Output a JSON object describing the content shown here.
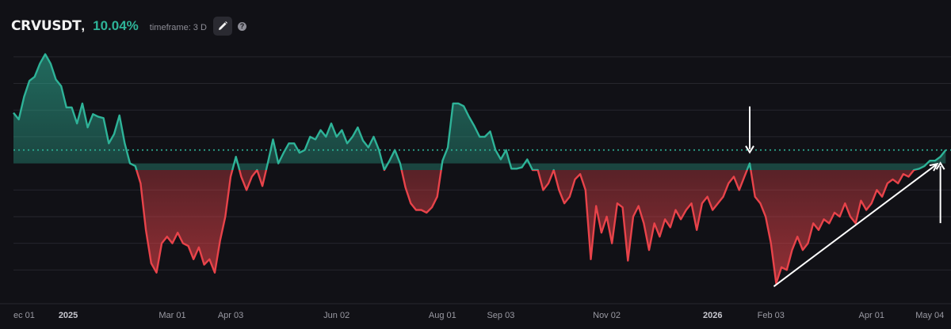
{
  "header": {
    "symbol": "CRVUSDT",
    "comma": ",",
    "change": "10.04%",
    "timeframe": "timeframe: 3 D",
    "edit_icon": "pencil-icon",
    "help_icon": "question-icon",
    "help_glyph": "?"
  },
  "colors": {
    "background": "#111116",
    "positive": "#2eb398",
    "negative": "#e8434a",
    "gridline": "#26262d",
    "annotation": "#ffffff"
  },
  "chart_data": {
    "type": "area",
    "title": "",
    "xlabel": "",
    "ylabel": "",
    "x_range": [
      "2024-12-01",
      "2026-05-16"
    ],
    "ylim": [
      -100,
      90
    ],
    "grid": true,
    "baseline": 0,
    "reference_line": {
      "value": 10.04,
      "style": "dotted"
    },
    "x_ticks": [
      {
        "label": "ec 01",
        "date": "2024-12-01",
        "year": false
      },
      {
        "label": "2025",
        "date": "2025-01-01",
        "year": true
      },
      {
        "label": "Mar 01",
        "date": "2025-03-01",
        "year": false
      },
      {
        "label": "Apr 03",
        "date": "2025-04-03",
        "year": false
      },
      {
        "label": "Jun 02",
        "date": "2025-06-02",
        "year": false
      },
      {
        "label": "Aug 01",
        "date": "2025-08-01",
        "year": false
      },
      {
        "label": "Sep 03",
        "date": "2025-09-03",
        "year": false
      },
      {
        "label": "Nov 02",
        "date": "2025-11-02",
        "year": false
      },
      {
        "label": "2026",
        "date": "2026-01-01",
        "year": true
      },
      {
        "label": "Feb 03",
        "date": "2026-02-03",
        "year": false
      },
      {
        "label": "Apr 01",
        "date": "2026-04-01",
        "year": false
      },
      {
        "label": "May 04",
        "date": "2026-05-04",
        "year": false
      }
    ],
    "series": [
      {
        "points": [
          [
            "2024-12-01",
            38
          ],
          [
            "2024-12-04",
            33
          ],
          [
            "2024-12-07",
            50
          ],
          [
            "2024-12-10",
            62
          ],
          [
            "2024-12-13",
            65
          ],
          [
            "2024-12-16",
            75
          ],
          [
            "2024-12-19",
            82
          ],
          [
            "2024-12-22",
            75
          ],
          [
            "2024-12-25",
            63
          ],
          [
            "2024-12-28",
            58
          ],
          [
            "2024-12-31",
            42
          ],
          [
            "2025-01-03",
            42
          ],
          [
            "2025-01-06",
            30
          ],
          [
            "2025-01-09",
            45
          ],
          [
            "2025-01-12",
            27
          ],
          [
            "2025-01-15",
            37
          ],
          [
            "2025-01-18",
            35
          ],
          [
            "2025-01-21",
            34
          ],
          [
            "2025-01-24",
            15
          ],
          [
            "2025-01-27",
            22
          ],
          [
            "2025-01-30",
            36
          ],
          [
            "2025-02-02",
            15
          ],
          [
            "2025-02-05",
            0
          ],
          [
            "2025-02-08",
            -2
          ],
          [
            "2025-02-11",
            -15
          ],
          [
            "2025-02-14",
            -50
          ],
          [
            "2025-02-17",
            -75
          ],
          [
            "2025-02-20",
            -82
          ],
          [
            "2025-02-23",
            -60
          ],
          [
            "2025-02-26",
            -55
          ],
          [
            "2025-03-01",
            -60
          ],
          [
            "2025-03-04",
            -52
          ],
          [
            "2025-03-07",
            -60
          ],
          [
            "2025-03-10",
            -62
          ],
          [
            "2025-03-13",
            -72
          ],
          [
            "2025-03-16",
            -63
          ],
          [
            "2025-03-19",
            -76
          ],
          [
            "2025-03-22",
            -72
          ],
          [
            "2025-03-25",
            -82
          ],
          [
            "2025-03-28",
            -58
          ],
          [
            "2025-03-31",
            -40
          ],
          [
            "2025-04-03",
            -10
          ],
          [
            "2025-04-06",
            5
          ],
          [
            "2025-04-09",
            -10
          ],
          [
            "2025-04-12",
            -20
          ],
          [
            "2025-04-15",
            -10
          ],
          [
            "2025-04-18",
            -5
          ],
          [
            "2025-04-21",
            -17
          ],
          [
            "2025-04-24",
            0
          ],
          [
            "2025-04-27",
            18
          ],
          [
            "2025-04-30",
            0
          ],
          [
            "2025-05-03",
            8
          ],
          [
            "2025-05-06",
            15
          ],
          [
            "2025-05-09",
            15
          ],
          [
            "2025-05-12",
            8
          ],
          [
            "2025-05-15",
            10
          ],
          [
            "2025-05-18",
            20
          ],
          [
            "2025-05-21",
            18
          ],
          [
            "2025-05-24",
            25
          ],
          [
            "2025-05-27",
            20
          ],
          [
            "2025-05-30",
            30
          ],
          [
            "2025-06-02",
            20
          ],
          [
            "2025-06-05",
            25
          ],
          [
            "2025-06-08",
            15
          ],
          [
            "2025-06-11",
            20
          ],
          [
            "2025-06-14",
            27
          ],
          [
            "2025-06-17",
            17
          ],
          [
            "2025-06-20",
            12
          ],
          [
            "2025-06-23",
            20
          ],
          [
            "2025-06-26",
            10
          ],
          [
            "2025-06-29",
            -5
          ],
          [
            "2025-07-02",
            2
          ],
          [
            "2025-07-05",
            10
          ],
          [
            "2025-07-08",
            0
          ],
          [
            "2025-07-11",
            -18
          ],
          [
            "2025-07-14",
            -30
          ],
          [
            "2025-07-17",
            -35
          ],
          [
            "2025-07-20",
            -35
          ],
          [
            "2025-07-23",
            -37
          ],
          [
            "2025-07-26",
            -33
          ],
          [
            "2025-07-29",
            -25
          ],
          [
            "2025-08-01",
            2
          ],
          [
            "2025-08-04",
            12
          ],
          [
            "2025-08-07",
            45
          ],
          [
            "2025-08-10",
            45
          ],
          [
            "2025-08-13",
            43
          ],
          [
            "2025-08-16",
            35
          ],
          [
            "2025-08-19",
            28
          ],
          [
            "2025-08-22",
            20
          ],
          [
            "2025-08-25",
            20
          ],
          [
            "2025-08-28",
            24
          ],
          [
            "2025-08-31",
            10
          ],
          [
            "2025-09-03",
            3
          ],
          [
            "2025-09-06",
            10
          ],
          [
            "2025-09-09",
            -4
          ],
          [
            "2025-09-12",
            -4
          ],
          [
            "2025-09-15",
            -3
          ],
          [
            "2025-09-18",
            3
          ],
          [
            "2025-09-21",
            -5
          ],
          [
            "2025-09-24",
            -5
          ],
          [
            "2025-09-27",
            -20
          ],
          [
            "2025-09-30",
            -15
          ],
          [
            "2025-10-03",
            -5
          ],
          [
            "2025-10-06",
            -20
          ],
          [
            "2025-10-09",
            -30
          ],
          [
            "2025-10-12",
            -25
          ],
          [
            "2025-10-15",
            -12
          ],
          [
            "2025-10-18",
            -8
          ],
          [
            "2025-10-21",
            -20
          ],
          [
            "2025-10-24",
            -72
          ],
          [
            "2025-10-27",
            -32
          ],
          [
            "2025-10-30",
            -52
          ],
          [
            "2025-11-02",
            -40
          ],
          [
            "2025-11-05",
            -60
          ],
          [
            "2025-11-08",
            -30
          ],
          [
            "2025-11-11",
            -33
          ],
          [
            "2025-11-14",
            -73
          ],
          [
            "2025-11-17",
            -40
          ],
          [
            "2025-11-20",
            -32
          ],
          [
            "2025-11-23",
            -45
          ],
          [
            "2025-11-26",
            -65
          ],
          [
            "2025-11-29",
            -45
          ],
          [
            "2025-12-02",
            -55
          ],
          [
            "2025-12-05",
            -42
          ],
          [
            "2025-12-08",
            -48
          ],
          [
            "2025-12-11",
            -35
          ],
          [
            "2025-12-14",
            -42
          ],
          [
            "2025-12-17",
            -35
          ],
          [
            "2025-12-20",
            -30
          ],
          [
            "2025-12-23",
            -50
          ],
          [
            "2025-12-26",
            -30
          ],
          [
            "2025-12-29",
            -25
          ],
          [
            "2026-01-01",
            -35
          ],
          [
            "2026-01-04",
            -30
          ],
          [
            "2026-01-07",
            -25
          ],
          [
            "2026-01-10",
            -15
          ],
          [
            "2026-01-13",
            -10
          ],
          [
            "2026-01-16",
            -20
          ],
          [
            "2026-01-19",
            -10
          ],
          [
            "2026-01-22",
            0
          ],
          [
            "2026-01-25",
            -25
          ],
          [
            "2026-01-28",
            -30
          ],
          [
            "2026-01-31",
            -40
          ],
          [
            "2026-02-03",
            -60
          ],
          [
            "2026-02-06",
            -90
          ],
          [
            "2026-02-09",
            -78
          ],
          [
            "2026-02-12",
            -80
          ],
          [
            "2026-02-15",
            -65
          ],
          [
            "2026-02-18",
            -55
          ],
          [
            "2026-02-21",
            -65
          ],
          [
            "2026-02-24",
            -60
          ],
          [
            "2026-02-27",
            -45
          ],
          [
            "2026-03-02",
            -50
          ],
          [
            "2026-03-05",
            -42
          ],
          [
            "2026-03-08",
            -45
          ],
          [
            "2026-03-11",
            -37
          ],
          [
            "2026-03-14",
            -40
          ],
          [
            "2026-03-17",
            -30
          ],
          [
            "2026-03-20",
            -40
          ],
          [
            "2026-03-23",
            -45
          ],
          [
            "2026-03-26",
            -28
          ],
          [
            "2026-03-29",
            -35
          ],
          [
            "2026-04-01",
            -30
          ],
          [
            "2026-04-04",
            -20
          ],
          [
            "2026-04-07",
            -25
          ],
          [
            "2026-04-10",
            -15
          ],
          [
            "2026-04-13",
            -12
          ],
          [
            "2026-04-16",
            -15
          ],
          [
            "2026-04-19",
            -8
          ],
          [
            "2026-04-22",
            -10
          ],
          [
            "2026-04-25",
            -5
          ],
          [
            "2026-04-28",
            -4
          ],
          [
            "2026-05-01",
            -2
          ],
          [
            "2026-05-04",
            2
          ],
          [
            "2026-05-07",
            2
          ],
          [
            "2026-05-10",
            5
          ],
          [
            "2026-05-13",
            10.04
          ]
        ]
      }
    ],
    "annotations": [
      {
        "type": "arrow-down",
        "x": "2026-01-22",
        "y": 0,
        "description": "vertical arrow pointing down to the 2026-01-22 peak"
      },
      {
        "type": "arrow-up",
        "x": "2026-05-10",
        "y": 5,
        "description": "vertical arrow pointing up to the 2026-05-10 value"
      },
      {
        "type": "trendline",
        "from": {
          "x": "2026-02-06",
          "y": -90
        },
        "to": {
          "x": "2026-05-10",
          "y": 2
        },
        "description": "rising trendline from the 2026-02-06 low"
      }
    ]
  }
}
